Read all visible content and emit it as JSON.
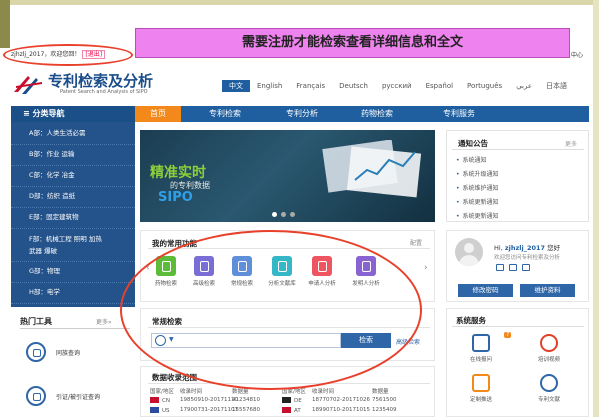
{
  "banner": {
    "text": "需要注册才能检索查看详细信息和全文"
  },
  "userbar": {
    "greeting": "zjhzlj_2017，欢迎您回！",
    "logout": "[退出]",
    "center": "中心"
  },
  "header": {
    "title": "专利检索及分析",
    "subtitle": "Patent Search and Analysis of SIPO"
  },
  "languages": [
    "中文",
    "English",
    "Français",
    "Deutsch",
    "русский",
    "Español",
    "Português",
    "عربي",
    "日本語"
  ],
  "nav": {
    "category_title": "≡ 分类导航",
    "items": [
      "首页",
      "专利检索",
      "专利分析",
      "药物检索",
      "专利服务"
    ]
  },
  "sidebar": {
    "items": [
      "A部：人类生活必需",
      "B部：作业  运输",
      "C部：化学  冶金",
      "D部：纺织  造纸",
      "E部：固定建筑物",
      "F部：机械工程  照明  加热  武器  爆破",
      "G部：物理",
      "H部：电学"
    ]
  },
  "tools": {
    "title": "热门工具",
    "more": "更多»",
    "items": [
      "同族查询",
      "引证/被引证查询"
    ]
  },
  "hero": {
    "title": "精准实时",
    "sub": "的专利数据",
    "brand": "SIPO"
  },
  "notice": {
    "title": "通知公告",
    "more": "更多",
    "items": [
      "系统通知",
      "系统升级通知",
      "系统维护通知",
      "系统更新通知",
      "系统更新通知"
    ]
  },
  "functions": {
    "title": "我的常用功能",
    "settings": "配置",
    "items": [
      {
        "label": "药物检索",
        "color": "#5dbb3a"
      },
      {
        "label": "高级检索",
        "color": "#7a6ed6"
      },
      {
        "label": "常规检索",
        "color": "#5f8fd8"
      },
      {
        "label": "分析文献库",
        "color": "#35b7c7"
      },
      {
        "label": "申请人分析",
        "color": "#ef5560"
      },
      {
        "label": "发明人分析",
        "color": "#8a63d2"
      }
    ]
  },
  "search": {
    "title": "常规检索",
    "button": "检索",
    "advanced": "高级检索"
  },
  "coverage": {
    "title": "数据收录范围",
    "headers": [
      "国家/地区",
      "收录时间",
      "数据量",
      "国家/地区",
      "收录时间",
      "数据量"
    ],
    "rows": [
      {
        "flag1": "#c8102e",
        "c1": "CN",
        "t1": "19850910-20171110",
        "n1": "41234810",
        "flag2": "#222222",
        "c2": "DE",
        "t2": "18770702-20171026",
        "n2": "7561500"
      },
      {
        "flag1": "#2b4aa0",
        "c1": "US",
        "t1": "17900731-20171107",
        "n1": "15557680",
        "flag2": "#c8102e",
        "c2": "AT",
        "t2": "18990710-20171015",
        "n2": "1235409"
      }
    ]
  },
  "user": {
    "hi": "Hi,",
    "name": "zjhzlj_2017",
    "suffix": "您好",
    "welcome": "欢迎您访问专利检索及分析",
    "buttons": [
      "修改密码",
      "维护资料"
    ]
  },
  "services": {
    "title": "系统服务",
    "badge": "7",
    "items": [
      {
        "label": "在线报问",
        "color": "#2e66a8"
      },
      {
        "label": "培训视频",
        "color": "#e0402a"
      },
      {
        "label": "定制推送",
        "color": "#f2891a"
      },
      {
        "label": "专利文献",
        "color": "#2e66a8"
      }
    ]
  },
  "colors": {
    "nav": "#1f5f9f",
    "active": "#f2891a",
    "sidebar": "#24528a",
    "banner": "#ee82ee",
    "oval": "#e8402a"
  }
}
